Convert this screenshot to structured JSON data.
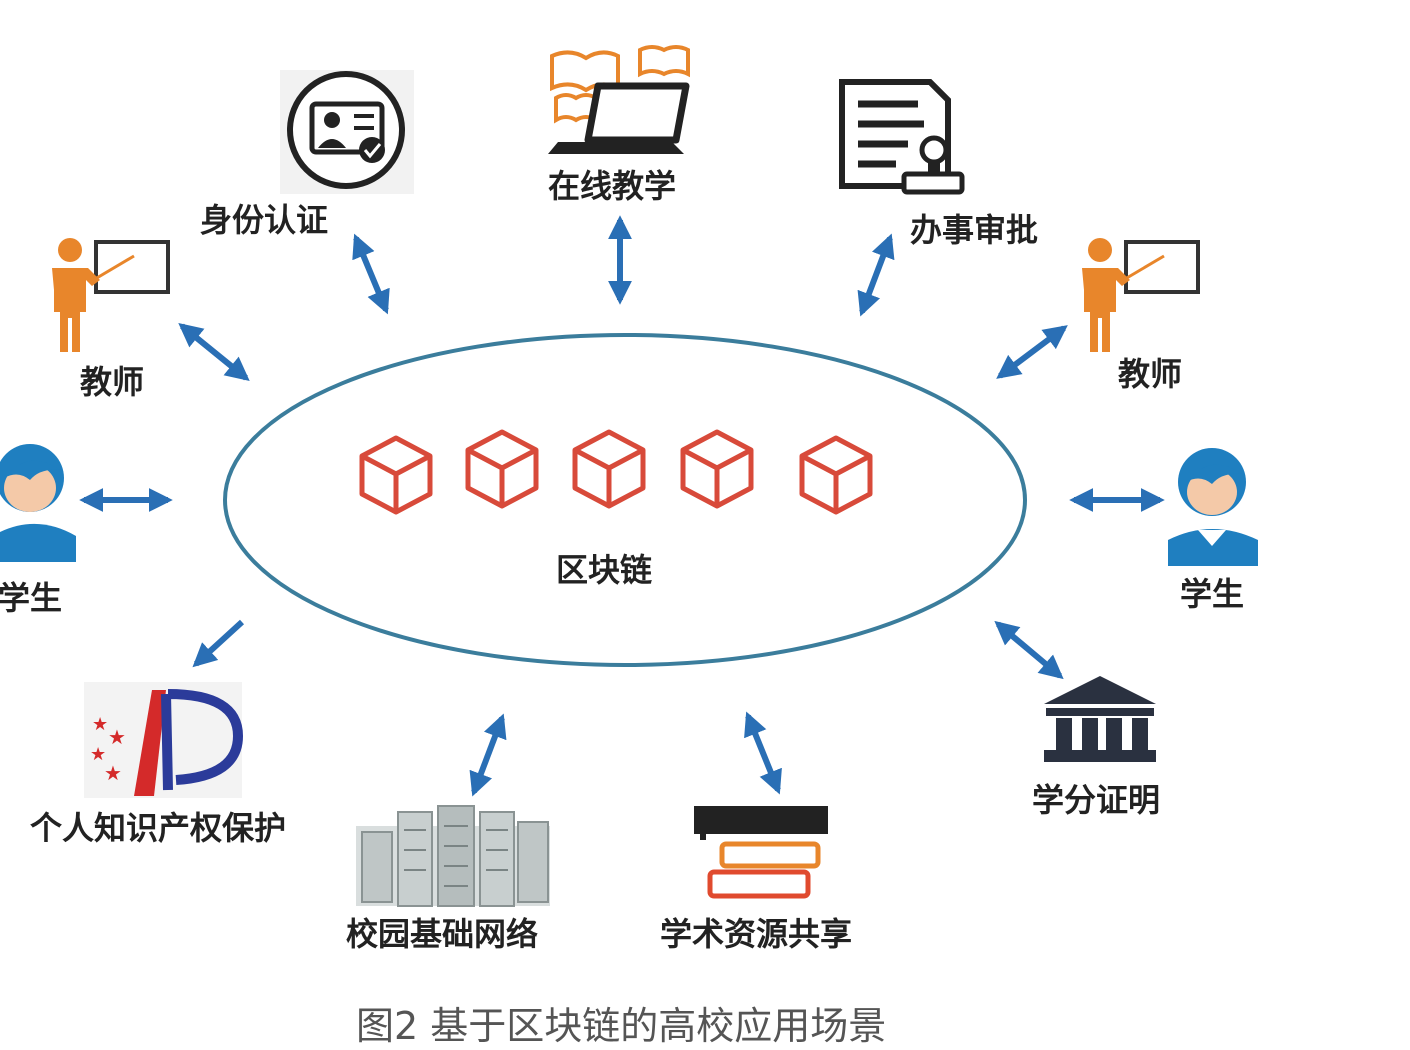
{
  "center": {
    "label": "区块链"
  },
  "nodes": {
    "identity": "身份认证",
    "online_teaching": "在线教学",
    "approval": "办事审批",
    "teacher_left": "教师",
    "teacher_right": "教师",
    "student_left": "学生",
    "student_right": "学生",
    "ip_protection": "个人知识产权保护",
    "campus_network": "校园基础网络",
    "academic_sharing": "学术资源共享",
    "credit_certificate": "学分证明"
  },
  "caption": "图2 基于区块链的高校应用场景",
  "colors": {
    "arrow": "#2a6fb5",
    "ellipse": "#3b7d9c",
    "block": "#d84a3a",
    "person_orange": "#e8862b",
    "person_blue": "#1f7fc0"
  }
}
